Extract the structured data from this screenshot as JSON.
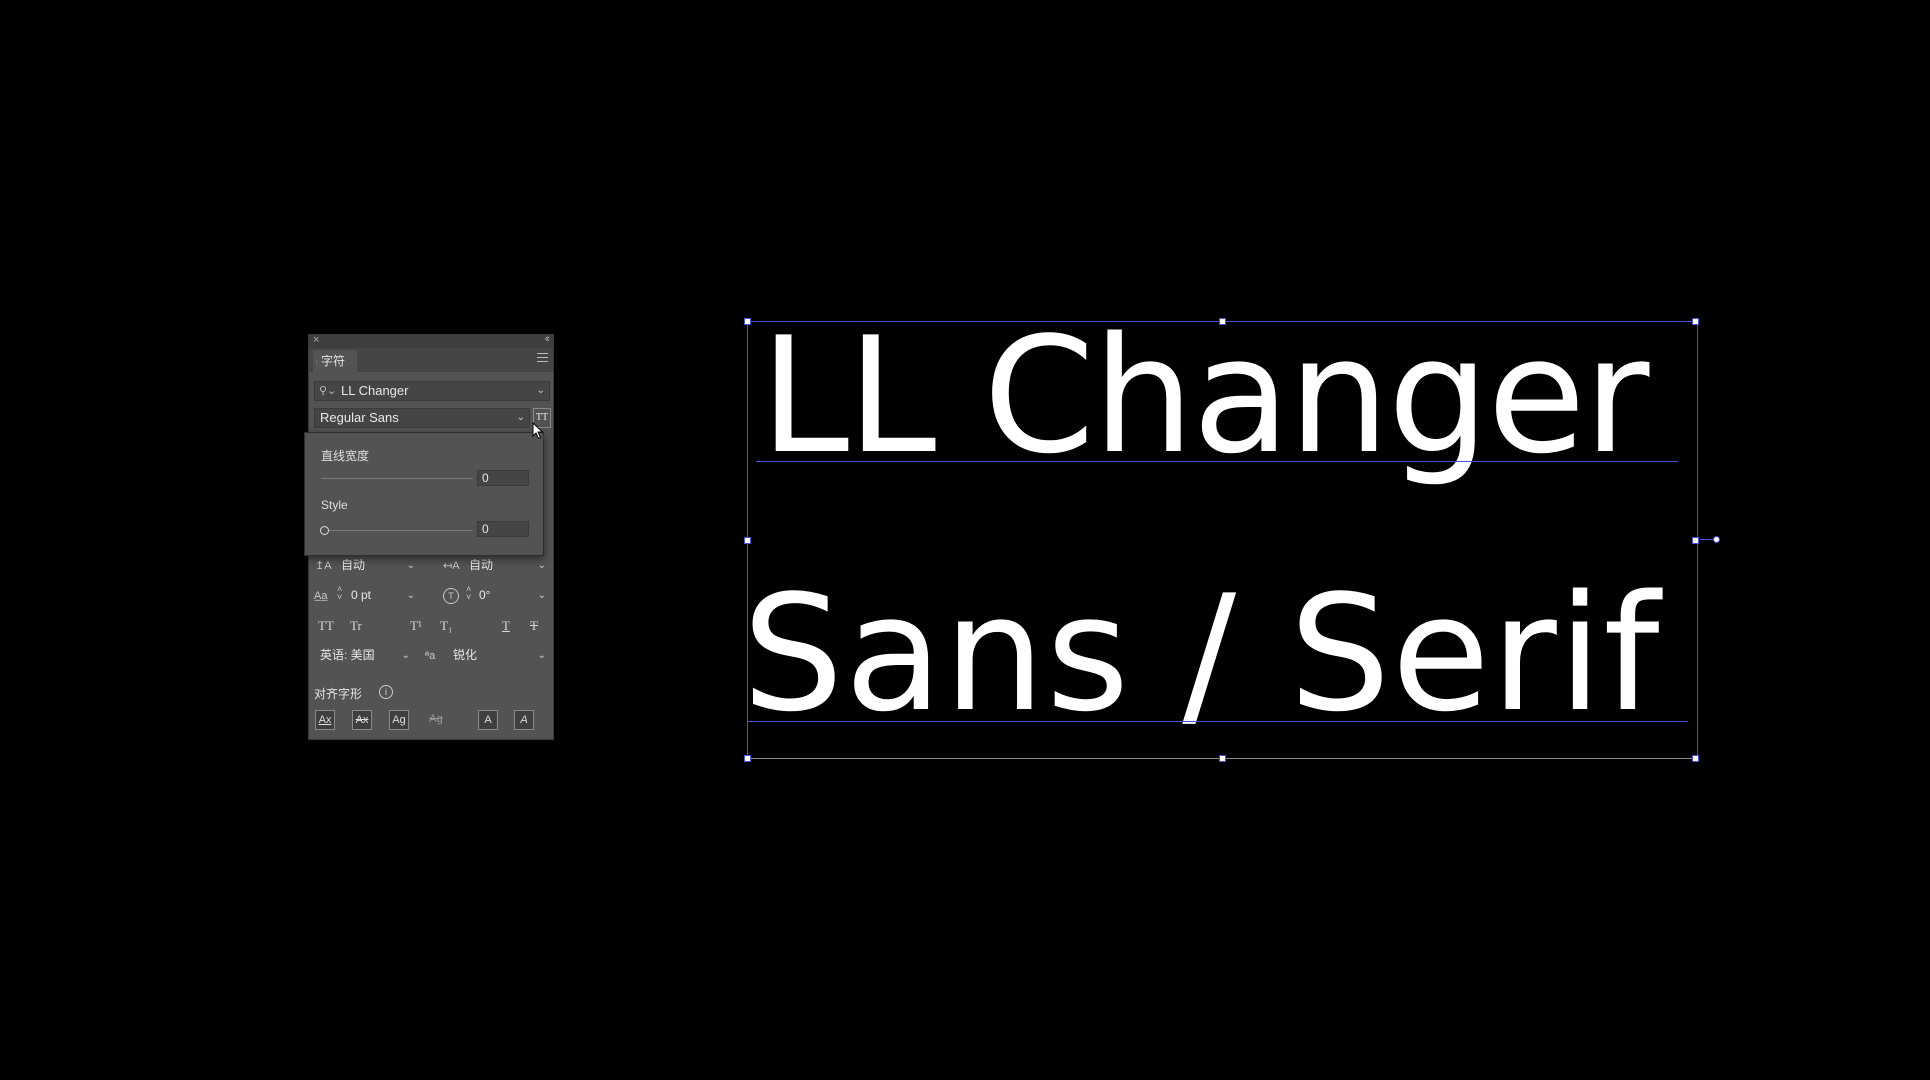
{
  "panel": {
    "tab_label": "字符",
    "close_glyph": "×",
    "collapse_glyph": "‹‹",
    "font_family": "LL Changer",
    "font_style": "Regular Sans",
    "variable_font_icon": "variable-font-icon",
    "leading_value": "自动",
    "kerning_value": "自动",
    "tracking_value": "0 pt",
    "rotation_value": "0°",
    "language": "英语: 美国",
    "antialias": "锐化",
    "aa_glyph": "ªa",
    "align_glyphs_label": "对齐字形",
    "text_style_buttons": [
      "TT",
      "Tr",
      "T¹",
      "T₁",
      "T",
      "T"
    ],
    "align_buttons": [
      "Ax",
      "Ax",
      "Ag",
      "Ag",
      "A",
      "A"
    ]
  },
  "popover": {
    "axis1_label": "直线宽度",
    "axis1_value": "0",
    "axis2_label": "Style",
    "axis2_value": "0"
  },
  "canvas": {
    "line1": "LL Changer",
    "line2": "Sans / Serif"
  },
  "colors": {
    "selection": "#4a4fd6",
    "panel_bg": "#535353",
    "canvas_bg": "#000000"
  }
}
